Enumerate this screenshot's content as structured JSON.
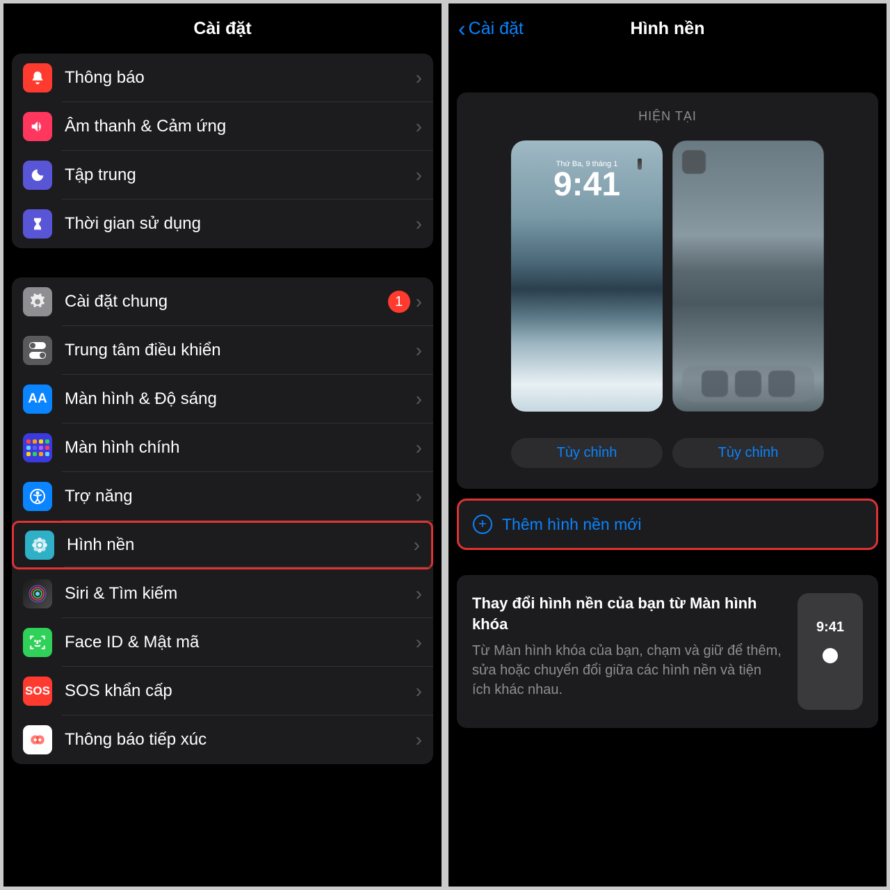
{
  "left": {
    "title": "Cài đặt",
    "groups": [
      {
        "items": [
          {
            "id": "notifications",
            "label": "Thông báo",
            "icon": "bell",
            "color": "#ff3b30"
          },
          {
            "id": "sounds",
            "label": "Âm thanh & Cảm ứng",
            "icon": "speaker",
            "color": "#ff375f"
          },
          {
            "id": "focus",
            "label": "Tập trung",
            "icon": "moon",
            "color": "#5856d6"
          },
          {
            "id": "screentime",
            "label": "Thời gian sử dụng",
            "icon": "hourglass",
            "color": "#5856d6"
          }
        ]
      },
      {
        "items": [
          {
            "id": "general",
            "label": "Cài đặt chung",
            "icon": "gear",
            "color": "#8e8e93",
            "badge": "1"
          },
          {
            "id": "control",
            "label": "Trung tâm điều khiển",
            "icon": "toggles",
            "color": "#5a5a5e"
          },
          {
            "id": "display",
            "label": "Màn hình & Độ sáng",
            "icon": "AA",
            "color": "#0a84ff"
          },
          {
            "id": "home",
            "label": "Màn hình chính",
            "icon": "grid",
            "color": "#3a3adf"
          },
          {
            "id": "accessibility",
            "label": "Trợ năng",
            "icon": "person",
            "color": "#0a84ff"
          },
          {
            "id": "wallpaper",
            "label": "Hình nền",
            "icon": "flower",
            "color": "#30b0c7",
            "highlighted": true
          },
          {
            "id": "siri",
            "label": "Siri & Tìm kiếm",
            "icon": "siri",
            "color": "#000"
          },
          {
            "id": "faceid",
            "label": "Face ID & Mật mã",
            "icon": "face",
            "color": "#30d158"
          },
          {
            "id": "sos",
            "label": "SOS khẩn cấp",
            "icon": "SOS",
            "color": "#ff3b30"
          },
          {
            "id": "exposure",
            "label": "Thông báo tiếp xúc",
            "icon": "exposure",
            "color": "#fff"
          }
        ]
      }
    ]
  },
  "right": {
    "back_label": "Cài đặt",
    "title": "Hình nền",
    "current_title": "HIỆN TẠI",
    "lock_date": "Thứ Ba, 9 tháng 1",
    "lock_time": "9:41",
    "customize_label": "Tùy chỉnh",
    "add_label": "Thêm hình nền mới",
    "tip_title": "Thay đổi hình nền của bạn từ Màn hình khóa",
    "tip_desc": "Từ Màn hình khóa của bạn, chạm và giữ để thêm, sửa hoặc chuyển đổi giữa các hình nền và tiện ích khác nhau.",
    "tip_time": "9:41"
  }
}
